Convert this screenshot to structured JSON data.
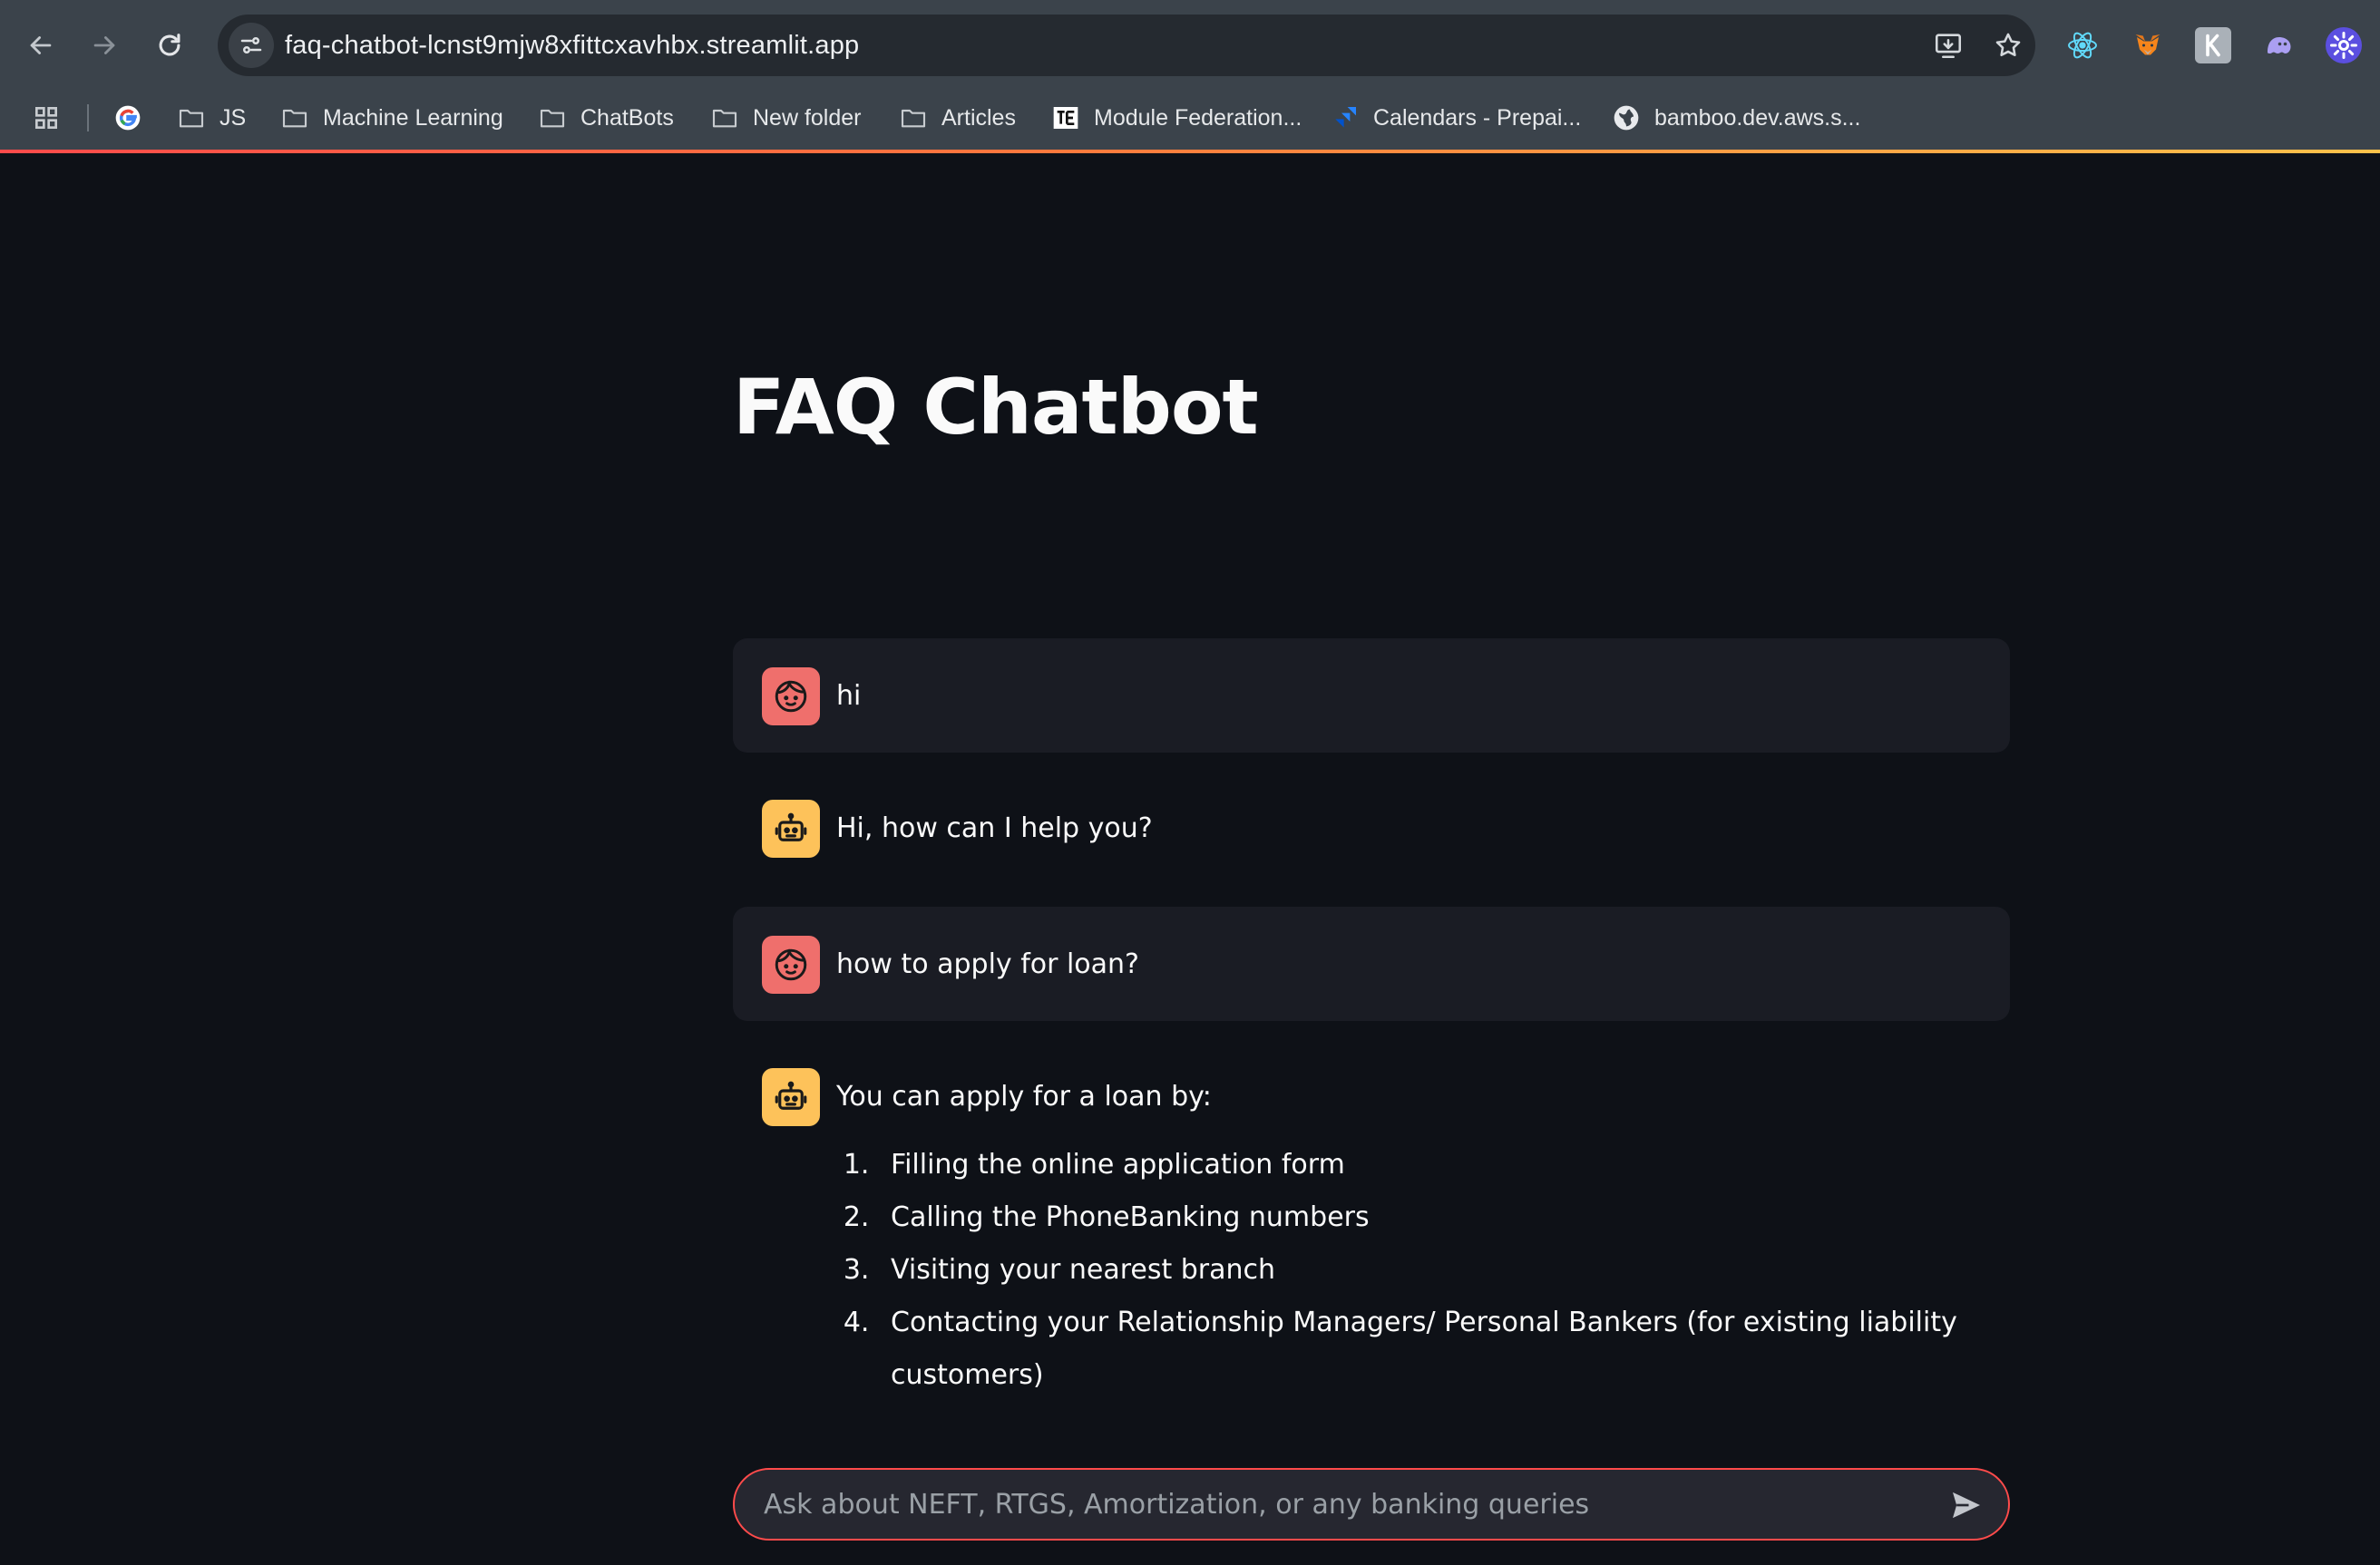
{
  "browser": {
    "url": "faq-chatbot-lcnst9mjw8xfittcxavhbx.streamlit.app",
    "nav_icons": [
      "back-arrow-icon",
      "forward-arrow-icon",
      "reload-icon"
    ],
    "omnibox_icons": [
      "site-info-icon",
      "install-app-icon",
      "bookmark-star-icon"
    ],
    "extensions": [
      "react-devtools-icon",
      "metamask-fox-icon",
      "k-extension-icon",
      "ghost-extension-icon",
      "gear-extension-icon"
    ],
    "bookmarks": [
      {
        "label": "JS",
        "icon": "folder-icon"
      },
      {
        "label": "Machine Learning",
        "icon": "folder-icon"
      },
      {
        "label": "ChatBots",
        "icon": "folder-icon"
      },
      {
        "label": "New folder",
        "icon": "folder-icon"
      },
      {
        "label": "Articles",
        "icon": "folder-icon"
      },
      {
        "label": "Module Federation...",
        "icon": "te-favicon-icon"
      },
      {
        "label": "Calendars - Prepai...",
        "icon": "jira-icon"
      },
      {
        "label": "bamboo.dev.aws.s...",
        "icon": "globe-icon"
      }
    ],
    "accent_colors": [
      "#ff4b4b",
      "#ff7a3d",
      "#ffc24b"
    ]
  },
  "app": {
    "title": "FAQ Chatbot",
    "messages": [
      {
        "role": "user",
        "avatar": "user-face-icon",
        "text": "hi"
      },
      {
        "role": "assistant",
        "avatar": "robot-icon",
        "text": "Hi, how can I help you?"
      },
      {
        "role": "user",
        "avatar": "user-face-icon",
        "text": "how to apply for loan?"
      },
      {
        "role": "assistant",
        "avatar": "robot-icon",
        "text": "You can apply for a loan by:",
        "list": [
          "Filling the online application form",
          "Calling the PhoneBanking numbers",
          "Visiting your nearest branch",
          "Contacting your Relationship Managers/ Personal Bankers (for existing liability customers)"
        ]
      }
    ],
    "chat_input": {
      "placeholder": "Ask about NEFT, RTGS, Amortization, or any banking queries",
      "value": "",
      "send_icon": "send-icon"
    },
    "colors": {
      "background": "#0e1117",
      "user_bubble": "#1a1c24",
      "user_avatar": "#ef6f6c",
      "bot_avatar": "#fdc25a",
      "input_border": "#ff4b4b"
    }
  }
}
